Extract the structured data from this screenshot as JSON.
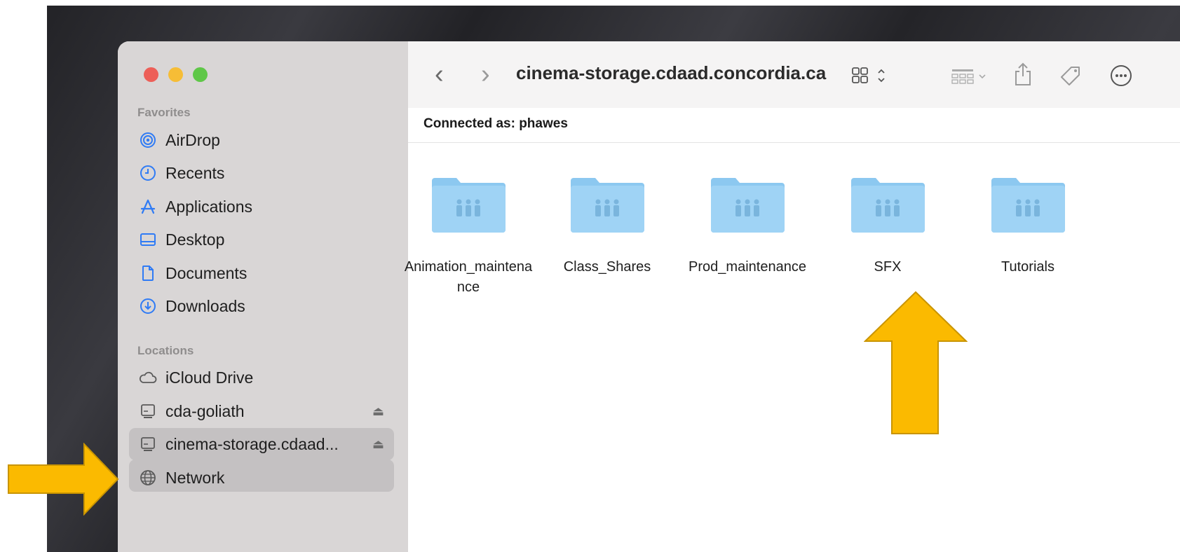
{
  "window": {
    "path_title": "cinema-storage.cdaad.concordia.ca",
    "connected_label": "Connected as: phawes"
  },
  "sidebar": {
    "favorites_title": "Favorites",
    "favorites": [
      {
        "label": "AirDrop",
        "icon": "airdrop-icon"
      },
      {
        "label": "Recents",
        "icon": "clock-icon"
      },
      {
        "label": "Applications",
        "icon": "applications-icon"
      },
      {
        "label": "Desktop",
        "icon": "desktop-icon"
      },
      {
        "label": "Documents",
        "icon": "document-icon"
      },
      {
        "label": "Downloads",
        "icon": "download-icon"
      }
    ],
    "locations_title": "Locations",
    "locations": [
      {
        "label": "iCloud Drive",
        "icon": "cloud-icon"
      },
      {
        "label": "cda-goliath",
        "icon": "server-icon",
        "eject": "⏏"
      },
      {
        "label": "cinema-storage.cdaad...",
        "icon": "server-icon",
        "eject": "⏏",
        "selected": true
      },
      {
        "label": "Network",
        "icon": "network-icon"
      }
    ]
  },
  "folders": [
    {
      "label": "Animation_maintenance"
    },
    {
      "label": "Class_Shares"
    },
    {
      "label": "Prod_maintenance"
    },
    {
      "label": "SFX"
    },
    {
      "label": "Tutorials"
    }
  ],
  "colors": {
    "accent": "#2f7bf5",
    "folder": "#8cc8f0",
    "arrow": "#fbba00",
    "selected_row": "#c4c1c2"
  }
}
